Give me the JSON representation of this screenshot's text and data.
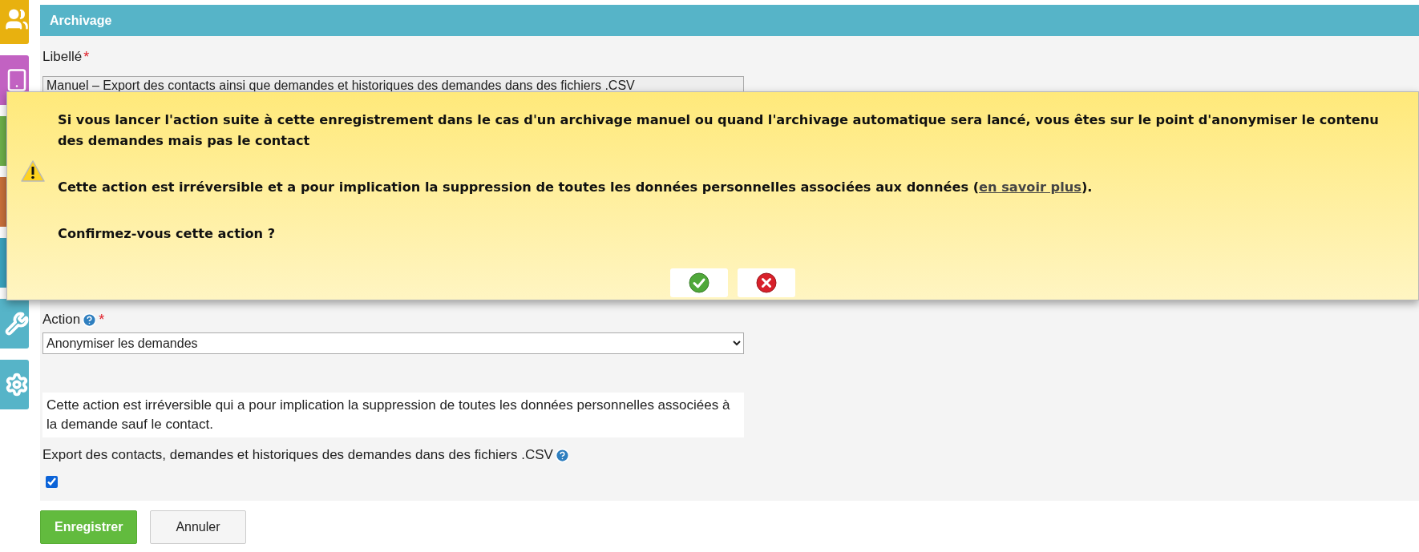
{
  "sidebar": {
    "items": [
      {
        "kind": "users",
        "color": "#e8b10f"
      },
      {
        "kind": "tablet",
        "color": "#c262c2"
      },
      {
        "kind": "blank",
        "color": "#6cb04a"
      },
      {
        "kind": "blank",
        "color": "#c9703a"
      },
      {
        "kind": "blank",
        "color": "#3aa3bf"
      },
      {
        "kind": "wrench",
        "color": "#56b4c8"
      },
      {
        "kind": "gear",
        "color": "#56b4c8"
      }
    ]
  },
  "panel": {
    "title": "Archivage",
    "label_field": {
      "label": "Libellé",
      "required_mark": "*",
      "value": "Manuel – Export des contacts ainsi que demandes et historiques des demandes dans des fichiers .CSV"
    },
    "action_field": {
      "label": "Action",
      "required_mark": "*",
      "value": "Anonymiser les demandes"
    },
    "info": "Cette action est irréversible qui a pour implication la suppression de toutes les données personnelles associées à la demande sauf le contact.",
    "export": {
      "label": "Export des contacts, demandes et historiques des demandes dans des fichiers .CSV",
      "checked": true
    }
  },
  "buttons": [
    {
      "kind": "primary",
      "label": "Enregistrer"
    },
    {
      "kind": "secondary",
      "label": "Annuler"
    }
  ],
  "dialog": {
    "message": "Si vous lancer l'action suite à cette enregistrement dans le cas d'un archivage manuel ou quand l'archivage automatique sera lancé, vous êtes sur le point d'anonymiser le contenu des demandes mais pas le contact",
    "warning": {
      "before": "Cette action est irréversible et a pour implication la suppression de toutes les données personnelles associées aux données (",
      "link": "en savoir plus",
      "after": ")."
    },
    "question": "Confirmez-vous cette action ?",
    "actions": [
      {
        "kind": "confirm"
      },
      {
        "kind": "cancel"
      }
    ]
  }
}
